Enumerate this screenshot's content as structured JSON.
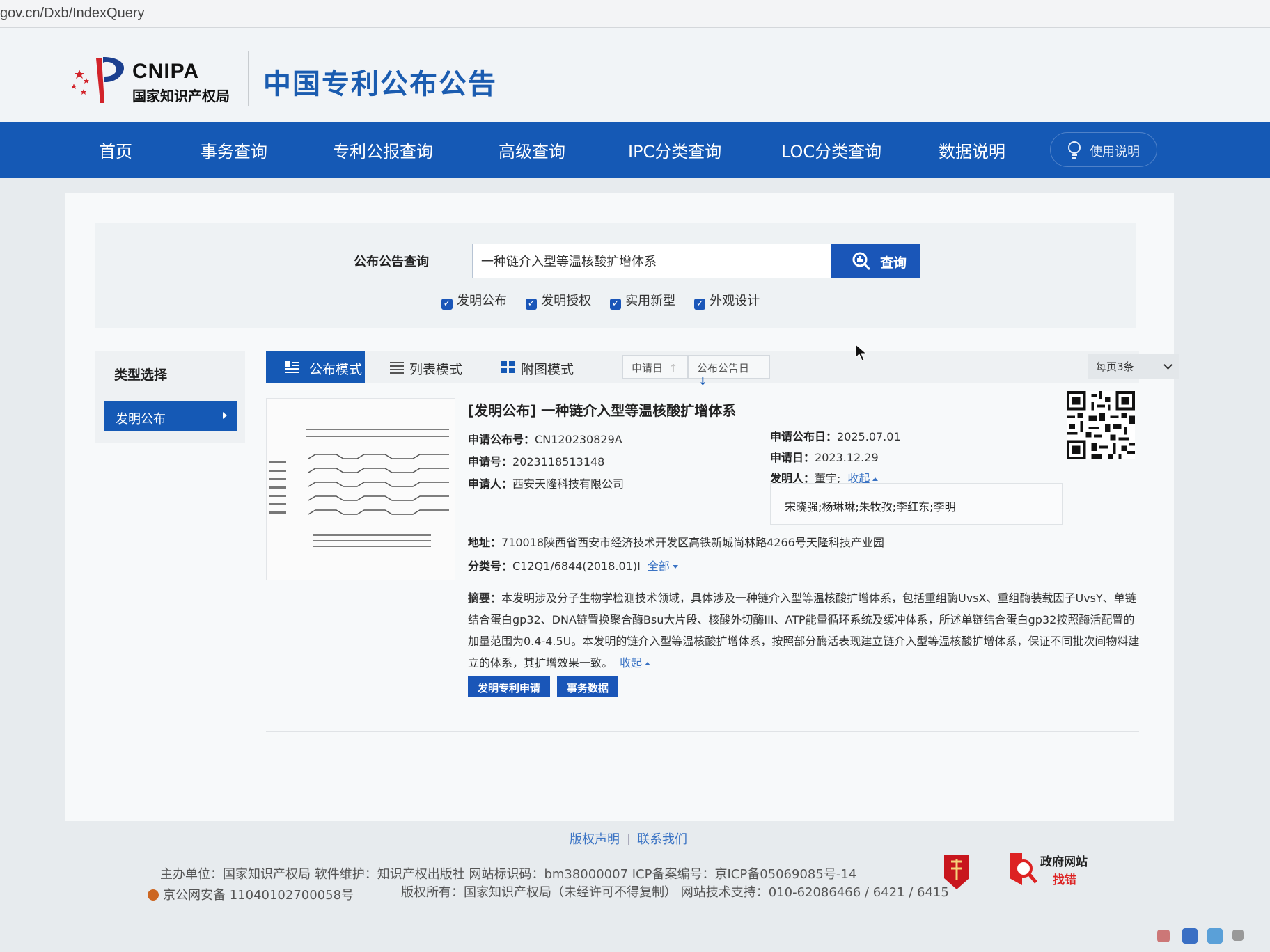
{
  "browser": {
    "url": "gov.cn/Dxb/IndexQuery"
  },
  "header": {
    "logo_en": "CNIPA",
    "logo_cn": "国家知识产权局",
    "site_title": "中国专利公布公告"
  },
  "nav": {
    "items": [
      "首页",
      "事务查询",
      "专利公报查询",
      "高级查询",
      "IPC分类查询",
      "LOC分类查询",
      "数据说明"
    ],
    "help_label": "使用说明"
  },
  "search": {
    "label": "公布公告查询",
    "value": "一种链介入型等温核酸扩增体系",
    "button_label": "查询",
    "filters": [
      "发明公布",
      "发明授权",
      "实用新型",
      "外观设计"
    ]
  },
  "sidebar": {
    "title": "类型选择",
    "selected": "发明公布"
  },
  "toolbar": {
    "modes": [
      "公布模式",
      "列表模式",
      "附图模式"
    ],
    "active_mode": "公布模式",
    "sort_options": [
      "申请日",
      "公布公告日"
    ],
    "per_page": "每页3条"
  },
  "result": {
    "title": "[发明公布] 一种链介入型等温核酸扩增体系",
    "pub_no_label": "申请公布号：",
    "pub_no": "CN120230829A",
    "app_no_label": "申请号：",
    "app_no": "2023118513148",
    "applicant_label": "申请人：",
    "applicant": "西安天隆科技有限公司",
    "pub_date_label": "申请公布日：",
    "pub_date": "2025.07.01",
    "app_date_label": "申请日：",
    "app_date": "2023.12.29",
    "inventor_label": "发明人：",
    "inventor_first": "董宇;",
    "collapse_label": "收起",
    "inventors_more": "宋晓强;杨琳琳;朱牧孜;李红东;李明",
    "address_label": "地址：",
    "address": "710018陕西省西安市经济技术开发区高铁新城尚林路4266号天隆科技产业园",
    "class_label": "分类号：",
    "class_value": "C12Q1/6844(2018.01)I",
    "class_all_label": "全部",
    "abstract_label": "摘要：",
    "abstract": "本发明涉及分子生物学检测技术领域，具体涉及一种链介入型等温核酸扩增体系，包括重组酶UvsX、重组酶装载因子UvsY、单链结合蛋白gp32、DNA链置换聚合酶Bsu大片段、核酸外切酶III、ATP能量循环系统及缓冲体系，所述单链结合蛋白gp32按照酶活配置的加量范围为0.4-4.5U。本发明的链介入型等温核酸扩增体系，按照部分酶活表现建立链介入型等温核酸扩增体系，保证不同批次间物料建立的体系，其扩增效果一致。",
    "abstract_collapse_label": "收起",
    "buttons": [
      "发明专利申请",
      "事务数据"
    ]
  },
  "footer": {
    "links": [
      "版权声明",
      "联系我们"
    ],
    "line1": "主办单位：国家知识产权局   软件维护：知识产权出版社   网站标识码：bm38000007   ICP备案编号：京ICP备05069085号-14",
    "line2": "版权所有：国家知识产权局（未经许可不得复制）   网站技术支持：010-62086466 / 6421 / 6415",
    "line3": "京公网安备 11040102700058号",
    "gov_t1": "政府网站",
    "gov_t2": "找错"
  },
  "colors": {
    "nav_bg": "#1559b5",
    "accent": "#1a56b8",
    "link": "#3a73c4"
  }
}
